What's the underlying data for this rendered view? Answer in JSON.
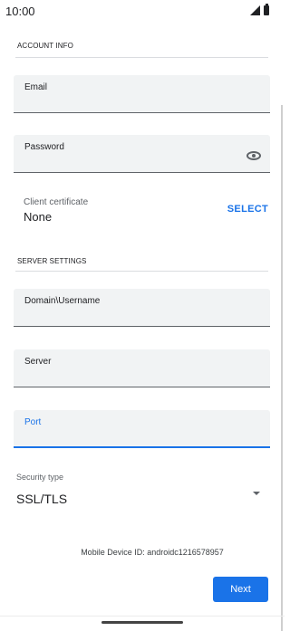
{
  "status_bar": {
    "time": "10:00",
    "icons": [
      "signal-icon",
      "battery-icon"
    ]
  },
  "account_info": {
    "header": "ACCOUNT INFO",
    "email_label": "Email",
    "password_label": "Password",
    "password_toggle_icon": "eye-icon",
    "client_certificate_label": "Client certificate",
    "client_certificate_value": "None",
    "select_label": "SELECT"
  },
  "server_settings": {
    "header": "SERVER SETTINGS",
    "domain_username_label": "Domain\\Username",
    "server_label": "Server",
    "port_label": "Port",
    "security_type_label": "Security type",
    "security_type_value": "SSL/TLS"
  },
  "footer": {
    "device_id": "Mobile Device ID: androidc1216578957",
    "next_label": "Next"
  },
  "colors": {
    "accent": "#1a73e8",
    "field_background": "#f1f3f4"
  }
}
